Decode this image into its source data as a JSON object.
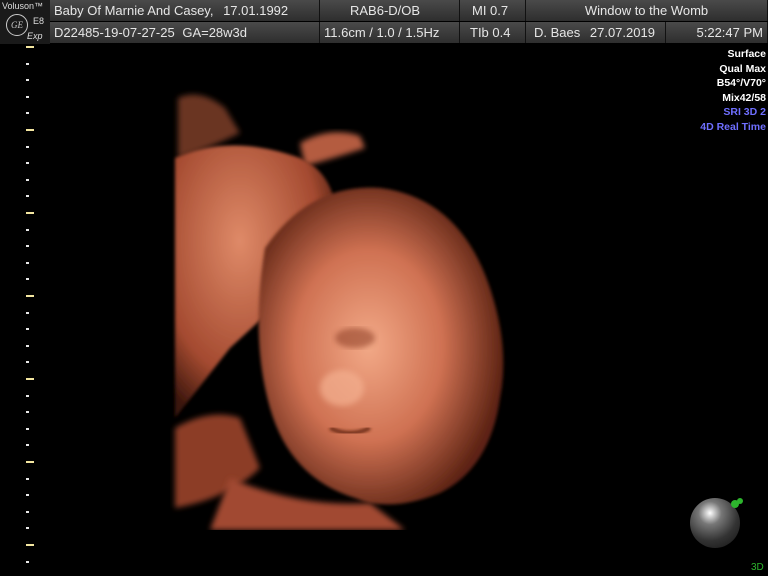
{
  "header": {
    "brand": "Voluson™",
    "logo_text": "GE",
    "model": "E8",
    "edition": "Exp",
    "patient": "Baby Of Marnie And Casey,",
    "dob": "17.01.1992",
    "probe": "RAB6-D/OB",
    "mi": "MI  0.7",
    "clinic": "Window to the Womb",
    "exam_id": "D22485-19-07-27-25",
    "ga": "GA=28w3d",
    "depth": "11.6cm / 1.0 / 1.5Hz",
    "tib": "TIb  0.4",
    "operator": "D. Baes",
    "date": "27.07.2019",
    "time": "5:22:47 PM"
  },
  "render_info": [
    {
      "text": "Surface",
      "color": "#ffffff"
    },
    {
      "text": "Qual Max",
      "color": "#ffffff"
    },
    {
      "text": "B54°/V70°",
      "color": "#ffffff"
    },
    {
      "text": "Mix42/58",
      "color": "#ffffff"
    },
    {
      "text": "SRI 3D 2",
      "color": "#6f6fff"
    },
    {
      "text": "4D Real Time",
      "color": "#6f6fff"
    }
  ],
  "mode_label": "3D",
  "colors": {
    "header_bg": "#3a3a3a",
    "tissue": "#c8694a",
    "tissue_light": "#e89a78",
    "tissue_dark": "#5a2416",
    "accent_blue": "#6f6fff",
    "accent_green": "#2db52d"
  }
}
